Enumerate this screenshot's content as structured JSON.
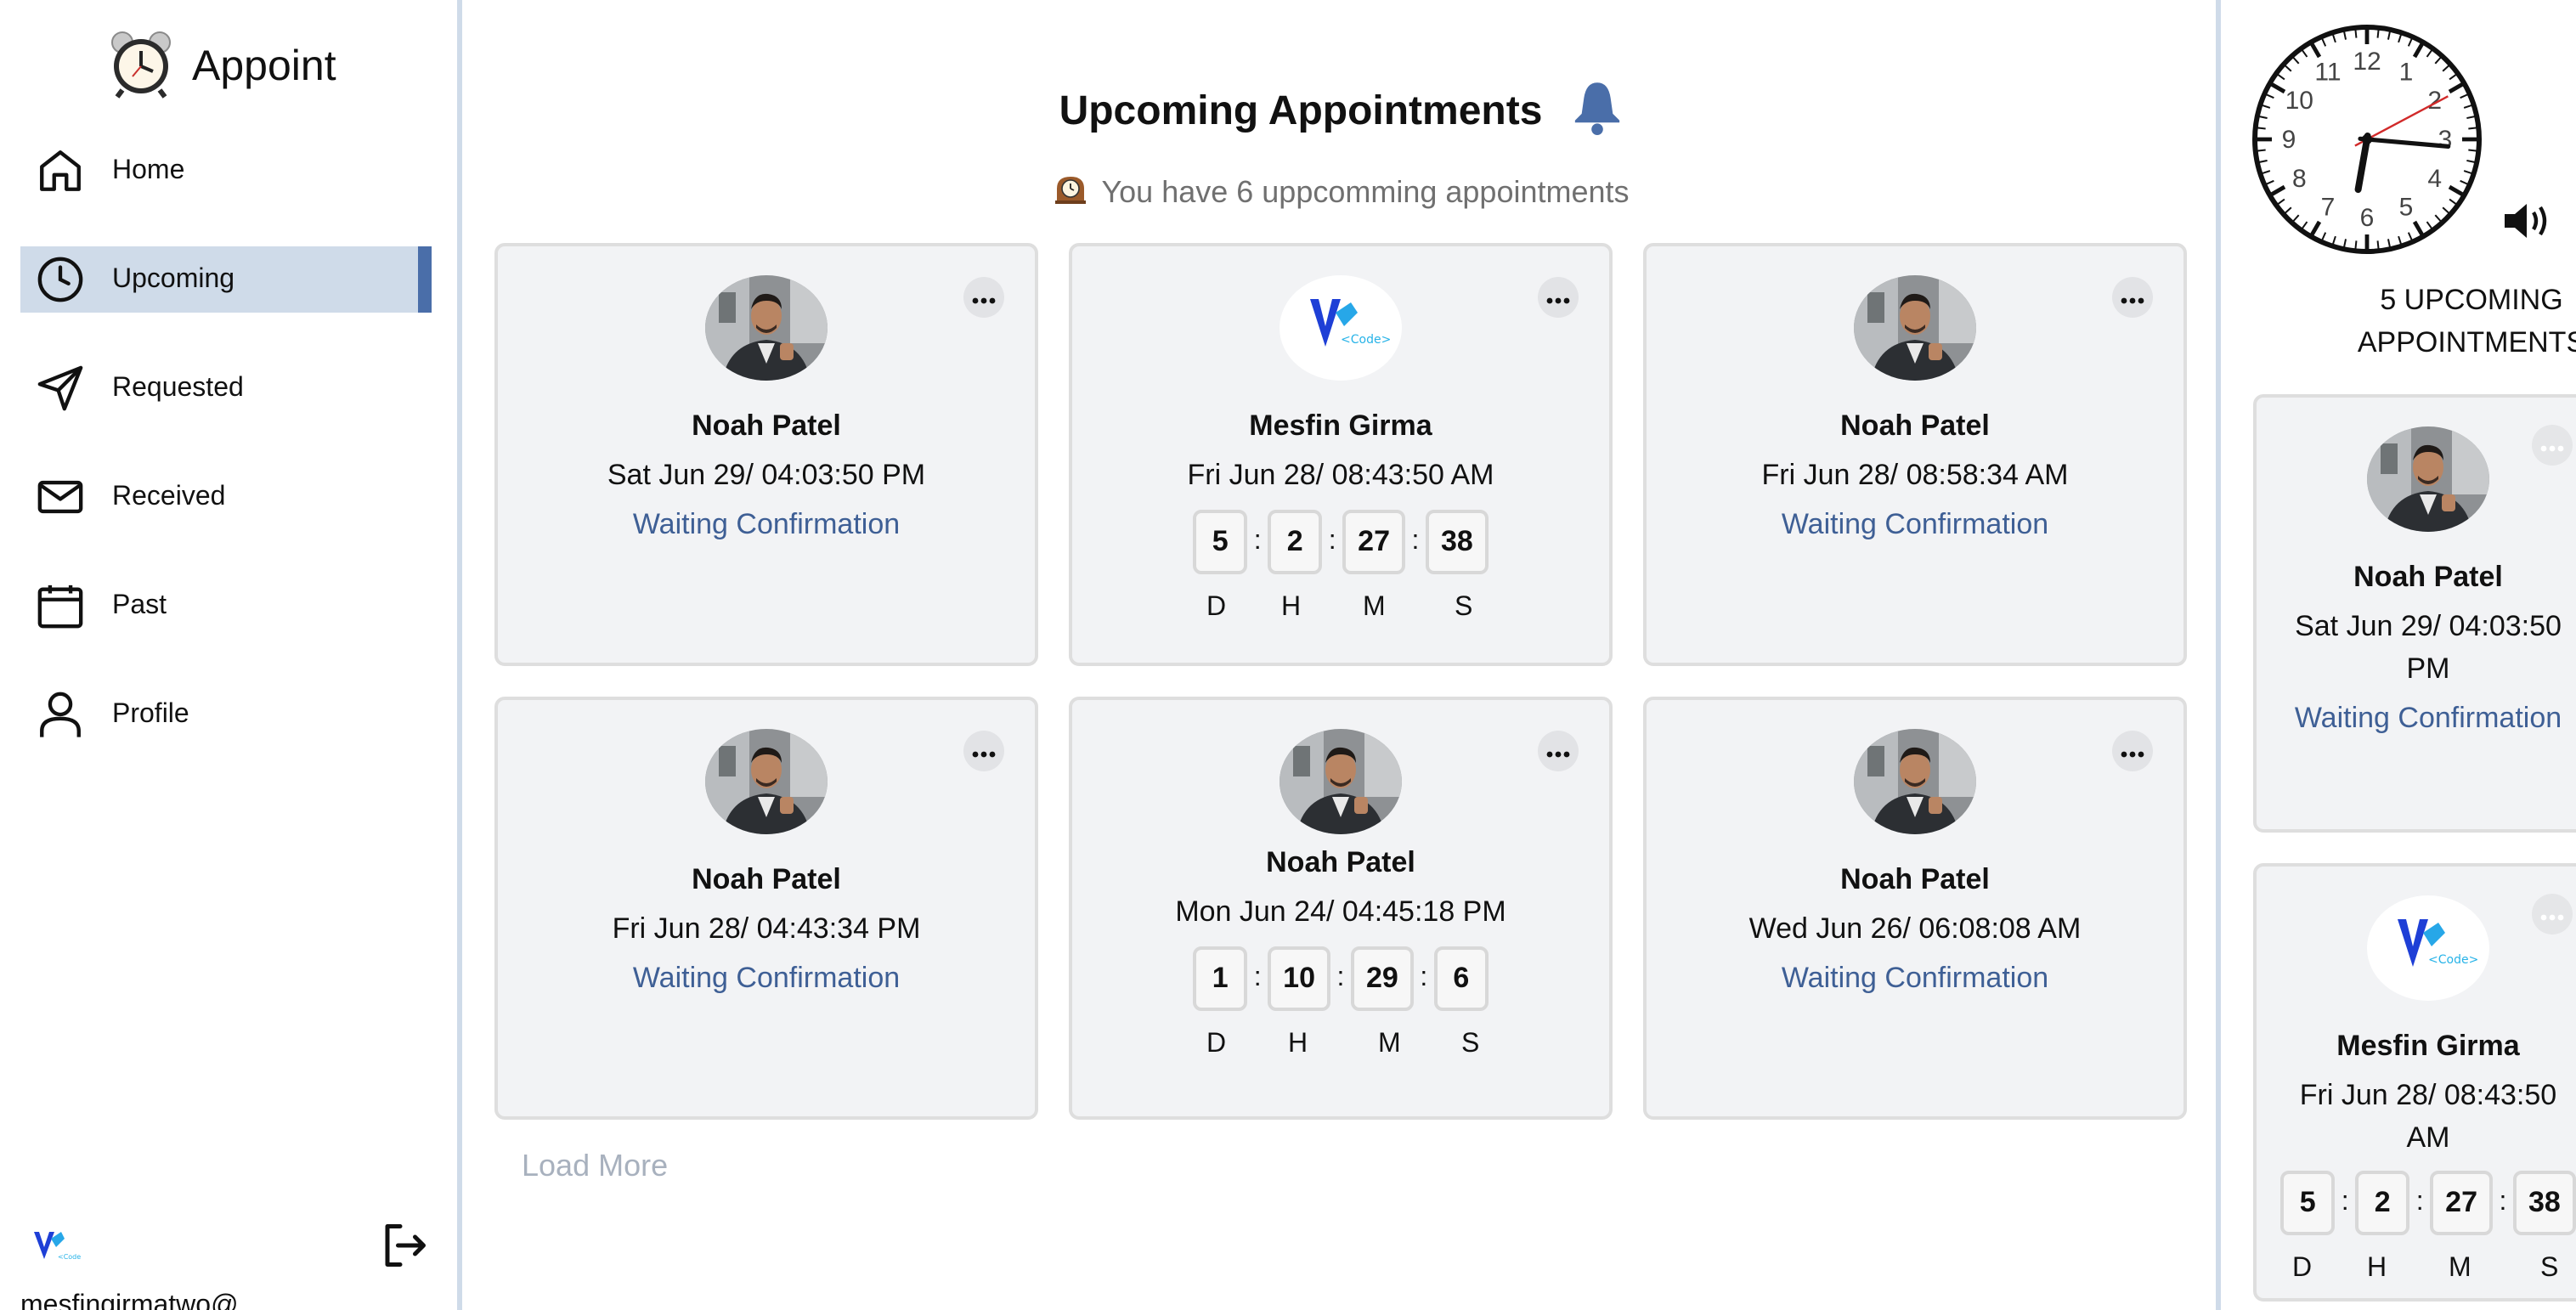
{
  "app": {
    "name": "Appoint"
  },
  "sidebar": {
    "items": [
      {
        "label": "Home",
        "icon": "home-icon"
      },
      {
        "label": "Upcoming",
        "icon": "clock-icon",
        "active": true
      },
      {
        "label": "Requested",
        "icon": "send-icon"
      },
      {
        "label": "Received",
        "icon": "mail-icon"
      },
      {
        "label": "Past",
        "icon": "calendar-icon"
      },
      {
        "label": "Profile",
        "icon": "user-icon"
      }
    ],
    "user_email": "mesfingirmatwo@...",
    "logout_icon": "logout-icon"
  },
  "main": {
    "title": "Upcoming Appointments",
    "subtitle": "You have 6 uppcomming appointments",
    "load_more": "Load More",
    "cards": [
      {
        "name": "Noah  Patel",
        "date": "Sat Jun 29/ 04:03:50 PM",
        "status": "Waiting Confirmation",
        "avatar": "person-photo"
      },
      {
        "name": "Mesfin  Girma",
        "date": "Fri Jun 28/ 08:43:50 AM",
        "avatar": "vcode-logo",
        "timer": {
          "d": "5",
          "h": "2",
          "m": "27",
          "s": "38"
        }
      },
      {
        "name": "Noah  Patel",
        "date": "Fri Jun 28/ 08:58:34 AM",
        "status": "Waiting Confirmation",
        "avatar": "person-photo"
      },
      {
        "name": "Noah  Patel",
        "date": "Fri Jun 28/ 04:43:34 PM",
        "status": "Waiting Confirmation",
        "avatar": "person-photo"
      },
      {
        "name": "Noah  Patel",
        "date": "Mon Jun 24/ 04:45:18 PM",
        "avatar": "person-photo",
        "timer": {
          "d": "1",
          "h": "10",
          "m": "29",
          "s": "6"
        }
      },
      {
        "name": "Noah  Patel",
        "date": "Wed Jun 26/ 06:08:08 AM",
        "status": "Waiting Confirmation",
        "avatar": "person-photo"
      }
    ]
  },
  "timer_labels": {
    "d": "D",
    "h": "H",
    "m": "M",
    "s": "S"
  },
  "right": {
    "count_line1": "5 UPCOMING",
    "count_line2": "APPOINTMENTS",
    "clock": {
      "hour_numbers": [
        "12",
        "1",
        "2",
        "3",
        "4",
        "5",
        "6",
        "7",
        "8",
        "9",
        "10",
        "11"
      ]
    },
    "cards": [
      {
        "name": "Noah  Patel",
        "date_line1": "Sat Jun 29/ 04:03:50",
        "date_line2": "PM",
        "status": "Waiting Confirmation"
      },
      {
        "name": "Mesfin  Girma",
        "date_line1": "Fri Jun 28/ 08:43:50",
        "date_line2": "AM",
        "timer": {
          "d": "5",
          "h": "2",
          "m": "27",
          "s": "38"
        }
      }
    ]
  },
  "colors": {
    "accent": "#4a6ea9",
    "active_bg": "#cfdbe9",
    "status": "#3e5f95",
    "card_bg": "#f2f3f5"
  }
}
